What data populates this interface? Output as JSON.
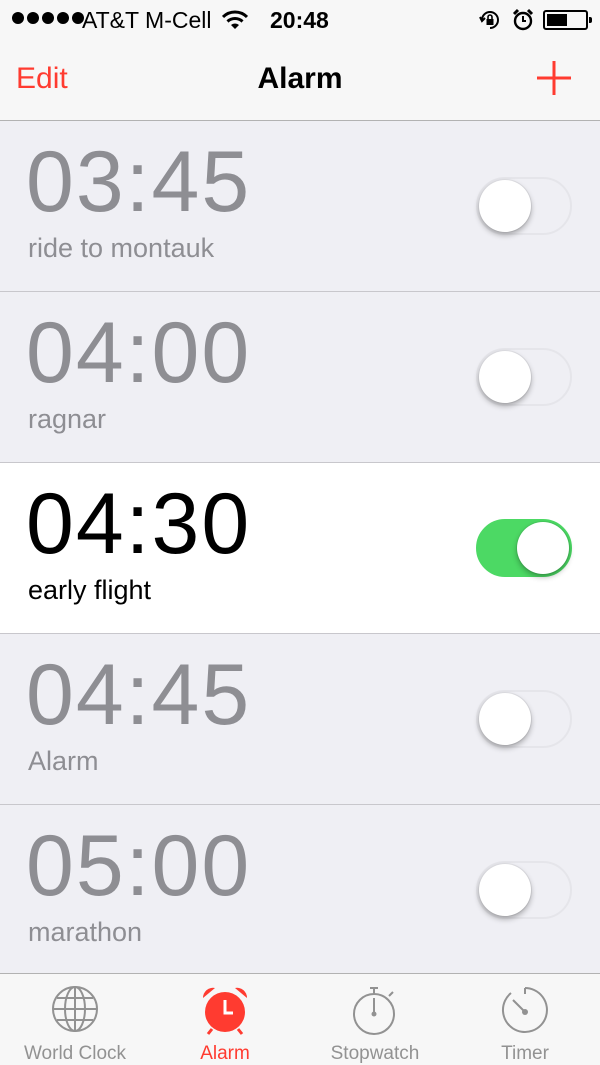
{
  "status": {
    "carrier": "AT&T M-Cell",
    "time": "20:48"
  },
  "nav": {
    "edit_label": "Edit",
    "title": "Alarm",
    "add_icon": "plus-icon"
  },
  "alarms": [
    {
      "time": "03:45",
      "label": "ride to montauk",
      "enabled": false
    },
    {
      "time": "04:00",
      "label": "ragnar",
      "enabled": false
    },
    {
      "time": "04:30",
      "label": "early flight",
      "enabled": true
    },
    {
      "time": "04:45",
      "label": "Alarm",
      "enabled": false
    },
    {
      "time": "05:00",
      "label": "marathon",
      "enabled": false
    }
  ],
  "tabs": [
    {
      "label": "World Clock",
      "icon": "globe-icon",
      "active": false
    },
    {
      "label": "Alarm",
      "icon": "alarm-clock-icon",
      "active": true
    },
    {
      "label": "Stopwatch",
      "icon": "stopwatch-icon",
      "active": false
    },
    {
      "label": "Timer",
      "icon": "timer-icon",
      "active": false
    }
  ],
  "colors": {
    "accent": "#ff3b30",
    "toggle_on": "#4cd964",
    "inactive_text": "#8e8e93",
    "background": "#efeff4"
  }
}
